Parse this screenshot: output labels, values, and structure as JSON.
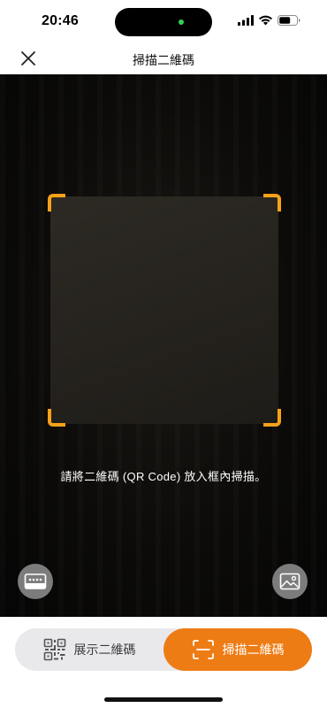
{
  "status_bar": {
    "time": "20:46",
    "icons": [
      "signal-icon",
      "wifi-icon",
      "battery-icon"
    ]
  },
  "nav": {
    "title": "掃描二維碼",
    "close_icon": "close-icon"
  },
  "scanner": {
    "hint": "請將二維碼 (QR Code) 放入框內掃描。",
    "frame_color": "#f5a219",
    "left_button_icon": "membership-card-icon",
    "right_button_icon": "photo-gallery-icon"
  },
  "tabs": {
    "show_label": "展示二維碼",
    "show_icon": "qr-code-icon",
    "scan_label": "掃描二維碼",
    "scan_icon": "scan-frame-icon",
    "active": "scan",
    "accent_color": "#ee7c14"
  }
}
